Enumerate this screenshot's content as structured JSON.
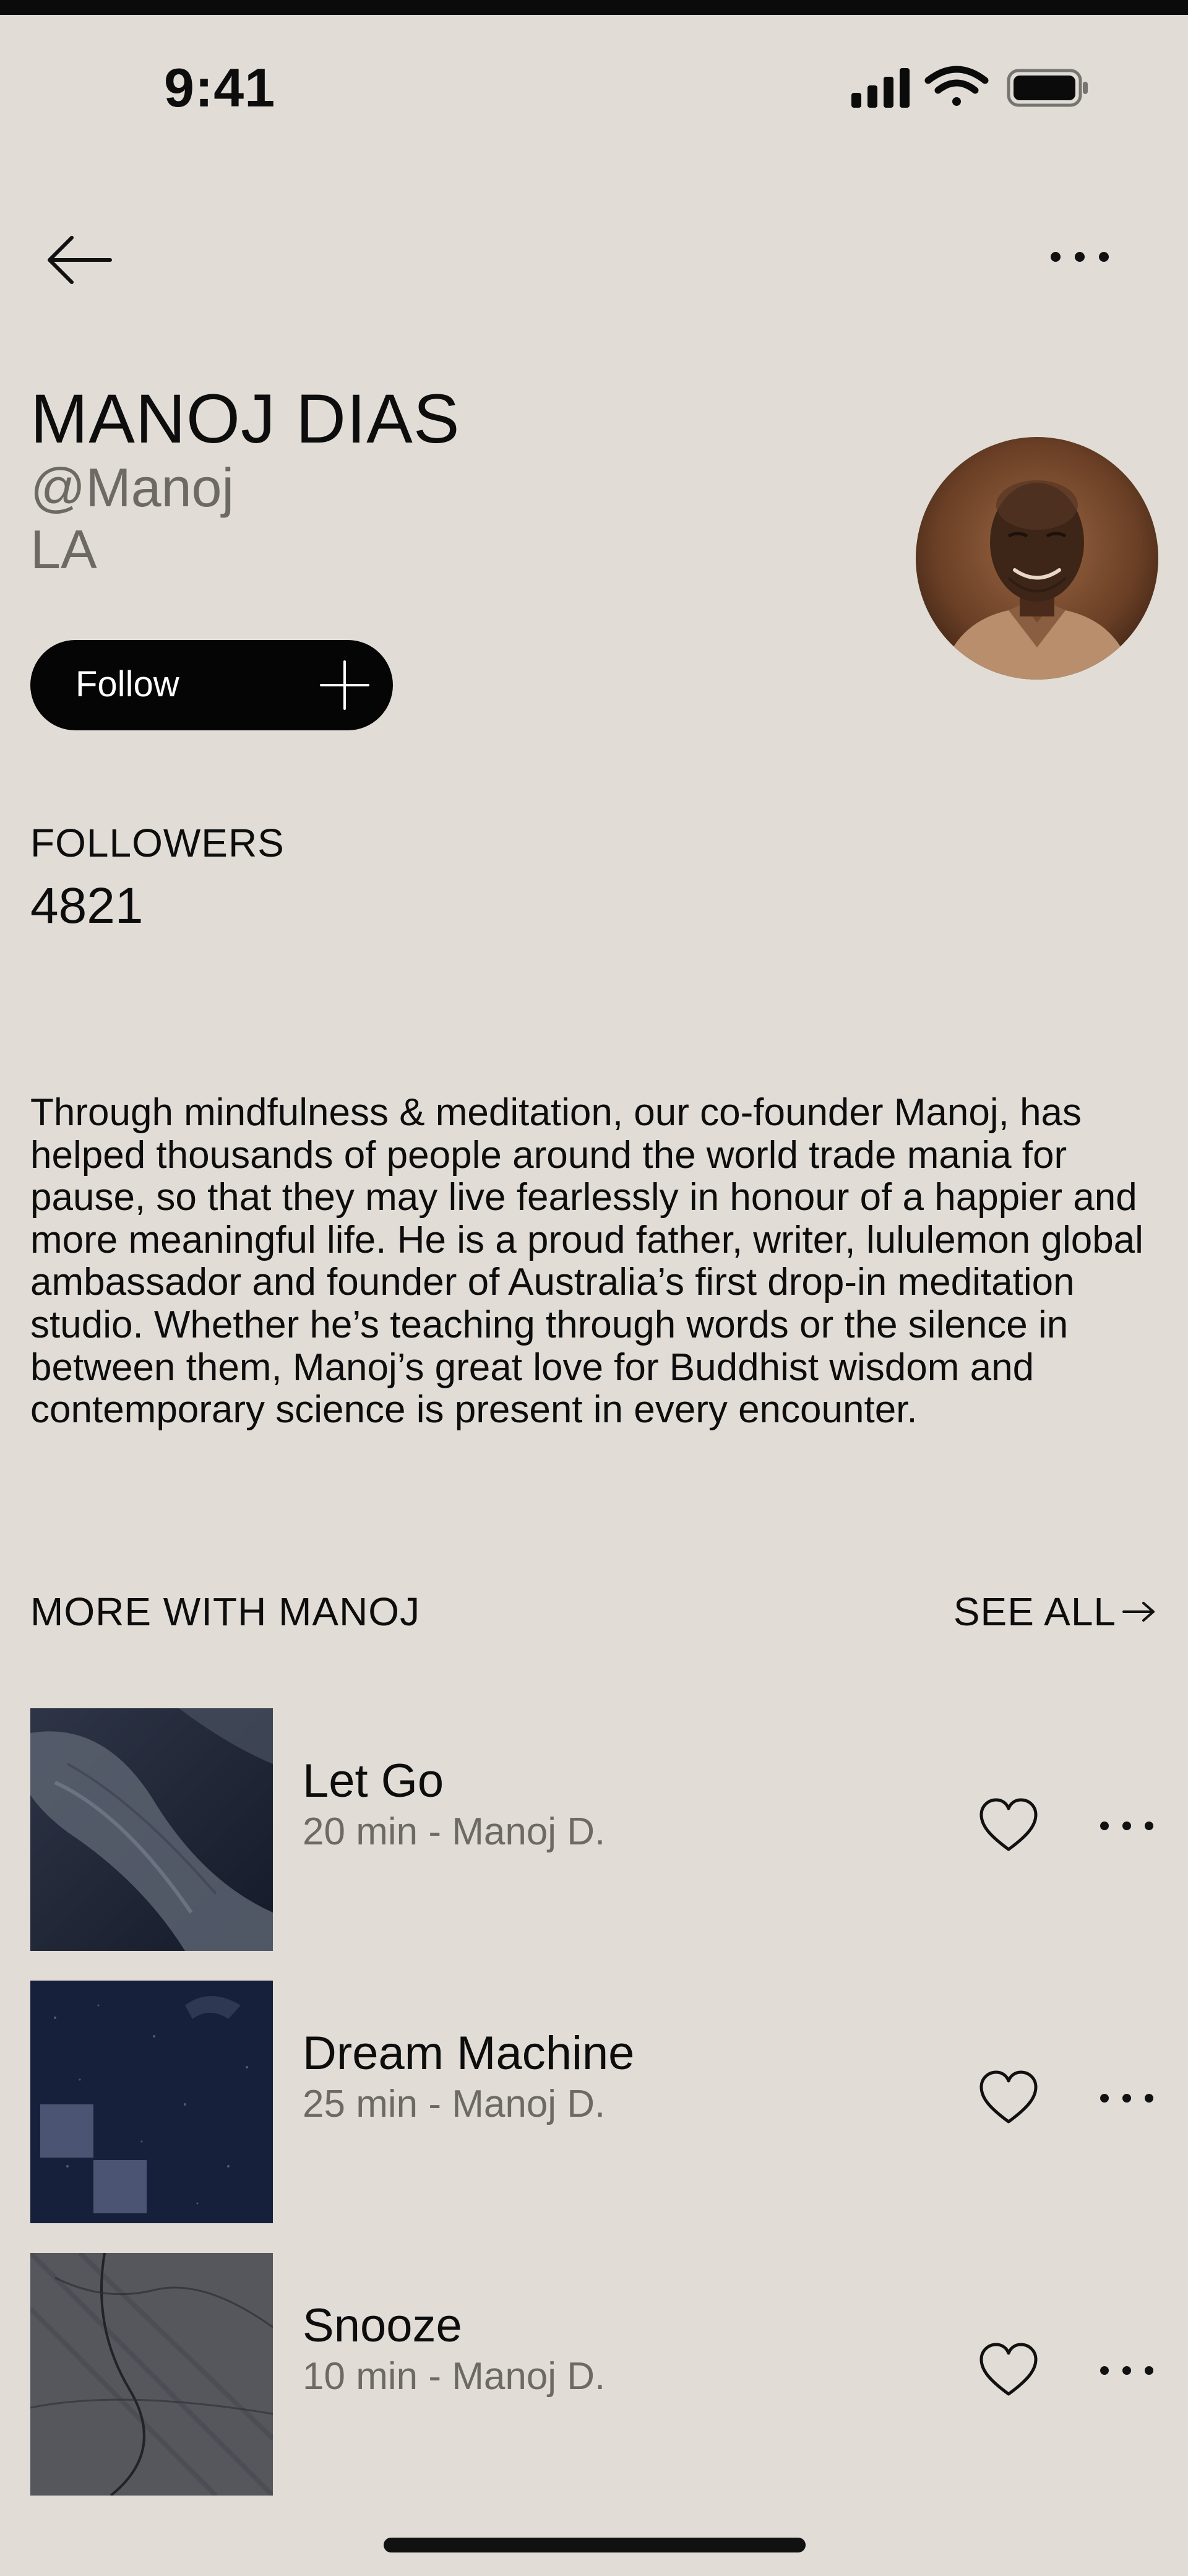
{
  "status_bar": {
    "time": "9:41"
  },
  "profile": {
    "name": "MANOJ DIAS",
    "handle": "@Manoj",
    "location": "LA",
    "follow_label": "Follow",
    "followers_label": "FOLLOWERS",
    "followers_count": "4821",
    "bio": "Through mindfulness & meditation, our co-founder Manoj, has helped thousands of people around the world trade mania for pause, so that they may live fearlessly in honour of a happier and more meaningful life. He is a proud father, writer, lululemon global ambassador and founder of Australia’s first drop-in meditation studio. Whether he’s teaching through words or the silence in between them, Manoj’s great love for Buddhist wisdom and contemporary science is present in every encounter."
  },
  "more_section": {
    "title": "MORE WITH MANOJ",
    "see_all_label": "SEE ALL",
    "see_all_icon": "arrow-right-icon",
    "tracks": [
      {
        "title": "Let Go",
        "meta": "20 min - Manoj D."
      },
      {
        "title": "Dream Machine",
        "meta": "25 min - Manoj D."
      },
      {
        "title": "Snooze",
        "meta": "10 min - Manoj D."
      }
    ]
  },
  "colors": {
    "background": "#e1ddd6",
    "text": "#0d0d0d",
    "muted_text": "#6d6a66",
    "button": "#050505"
  }
}
